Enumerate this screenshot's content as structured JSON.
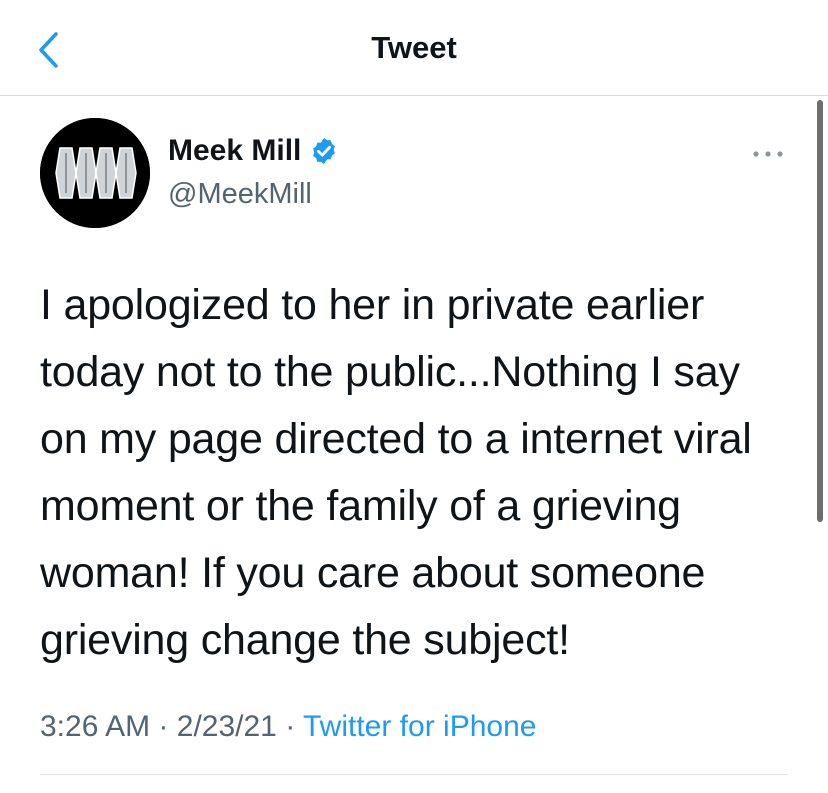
{
  "header": {
    "title": "Tweet",
    "back_icon": "chevron-left-icon"
  },
  "author": {
    "display_name": "Meek Mill",
    "handle": "@MeekMill",
    "verified_icon": "verified-badge-icon",
    "avatar_icon": "avatar-image"
  },
  "more_icon": "ellipsis-icon",
  "tweet": {
    "lines": [
      "I apologized to her in private earlier",
      "today not to the public...Nothing I say",
      "on my page directed to a internet viral",
      "moment or the family of a grieving",
      "woman! If you care about someone",
      "grieving change the subject!"
    ]
  },
  "meta": {
    "time": "3:26 AM",
    "separator": "·",
    "date": "2/23/21",
    "source": "Twitter for iPhone"
  },
  "colors": {
    "accent": "#1d9bf0",
    "secondary_text": "#536471",
    "primary_text": "#0f1419"
  }
}
